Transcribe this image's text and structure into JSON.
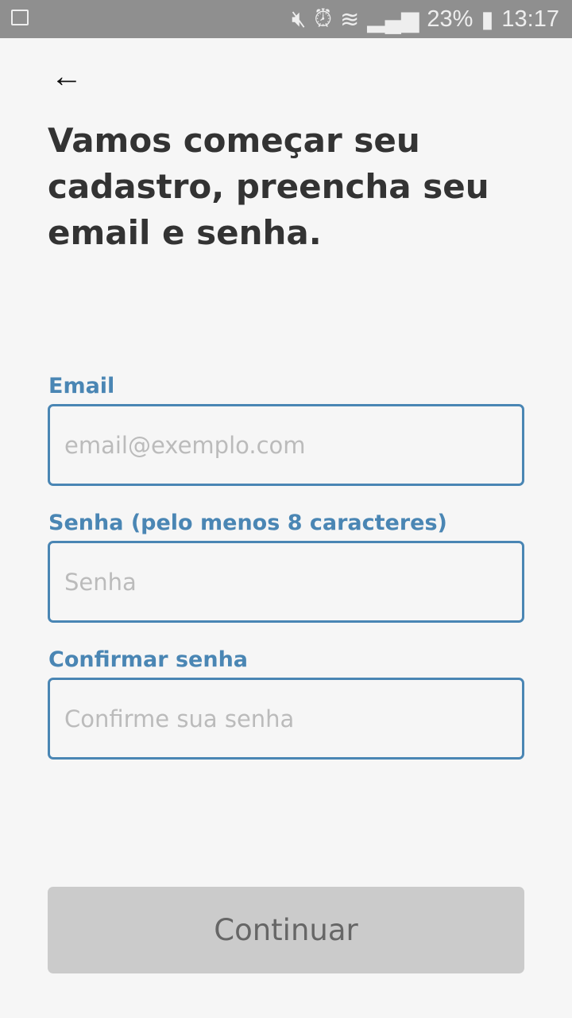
{
  "status": {
    "battery": "23%",
    "time": "13:17"
  },
  "title": "Vamos começar seu cadastro, preencha seu email e senha.",
  "fields": [
    {
      "label": "Email",
      "placeholder": "email@exemplo.com"
    },
    {
      "label": "Senha (pelo menos 8 caracteres)",
      "placeholder": "Senha"
    },
    {
      "label": "Confirmar senha",
      "placeholder": "Confirme sua senha"
    }
  ],
  "button": "Continuar"
}
